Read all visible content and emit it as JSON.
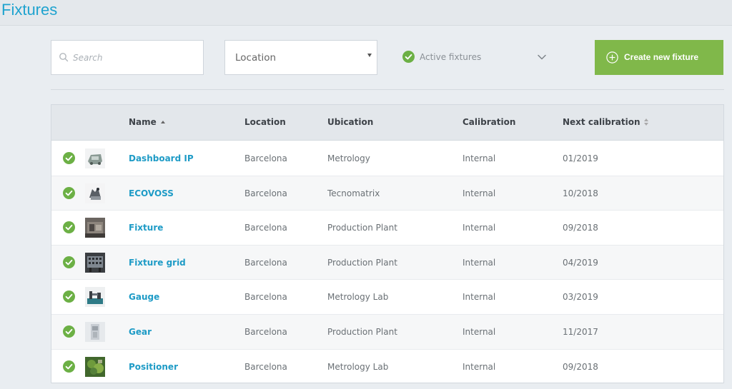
{
  "page": {
    "title": "Fixtures"
  },
  "toolbar": {
    "search_placeholder": "Search",
    "location_value": "Location",
    "active_filter_label": "Active fixtures",
    "create_label": "Create new fixture"
  },
  "colors": {
    "accent": "#1fa3cf",
    "create_button": "#80b84a",
    "status_active": "#6cb045"
  },
  "table": {
    "headers": [
      "Name",
      "Location",
      "Ubication",
      "Calibration",
      "Next calibration"
    ],
    "rows": [
      {
        "name": "Dashboard IP",
        "location": "Barcelona",
        "ubication": "Metrology",
        "calibration": "Internal",
        "next": "01/2019",
        "thumb": "dashboard-thumbnail"
      },
      {
        "name": "ECOVOSS",
        "location": "Barcelona",
        "ubication": "Tecnomatrix",
        "calibration": "Internal",
        "next": "10/2018",
        "thumb": "ecovoss-thumbnail"
      },
      {
        "name": "Fixture",
        "location": "Barcelona",
        "ubication": "Production Plant",
        "calibration": "Internal",
        "next": "09/2018",
        "thumb": "fixture-thumbnail"
      },
      {
        "name": "Fixture grid",
        "location": "Barcelona",
        "ubication": "Production Plant",
        "calibration": "Internal",
        "next": "04/2019",
        "thumb": "fixture-grid-thumbnail"
      },
      {
        "name": "Gauge",
        "location": "Barcelona",
        "ubication": "Metrology Lab",
        "calibration": "Internal",
        "next": "03/2019",
        "thumb": "gauge-thumbnail"
      },
      {
        "name": "Gear",
        "location": "Barcelona",
        "ubication": "Production Plant",
        "calibration": "Internal",
        "next": "11/2017",
        "thumb": "gear-thumbnail"
      },
      {
        "name": "Positioner",
        "location": "Barcelona",
        "ubication": "Metrology Lab",
        "calibration": "Internal",
        "next": "09/2018",
        "thumb": "positioner-thumbnail"
      }
    ]
  }
}
